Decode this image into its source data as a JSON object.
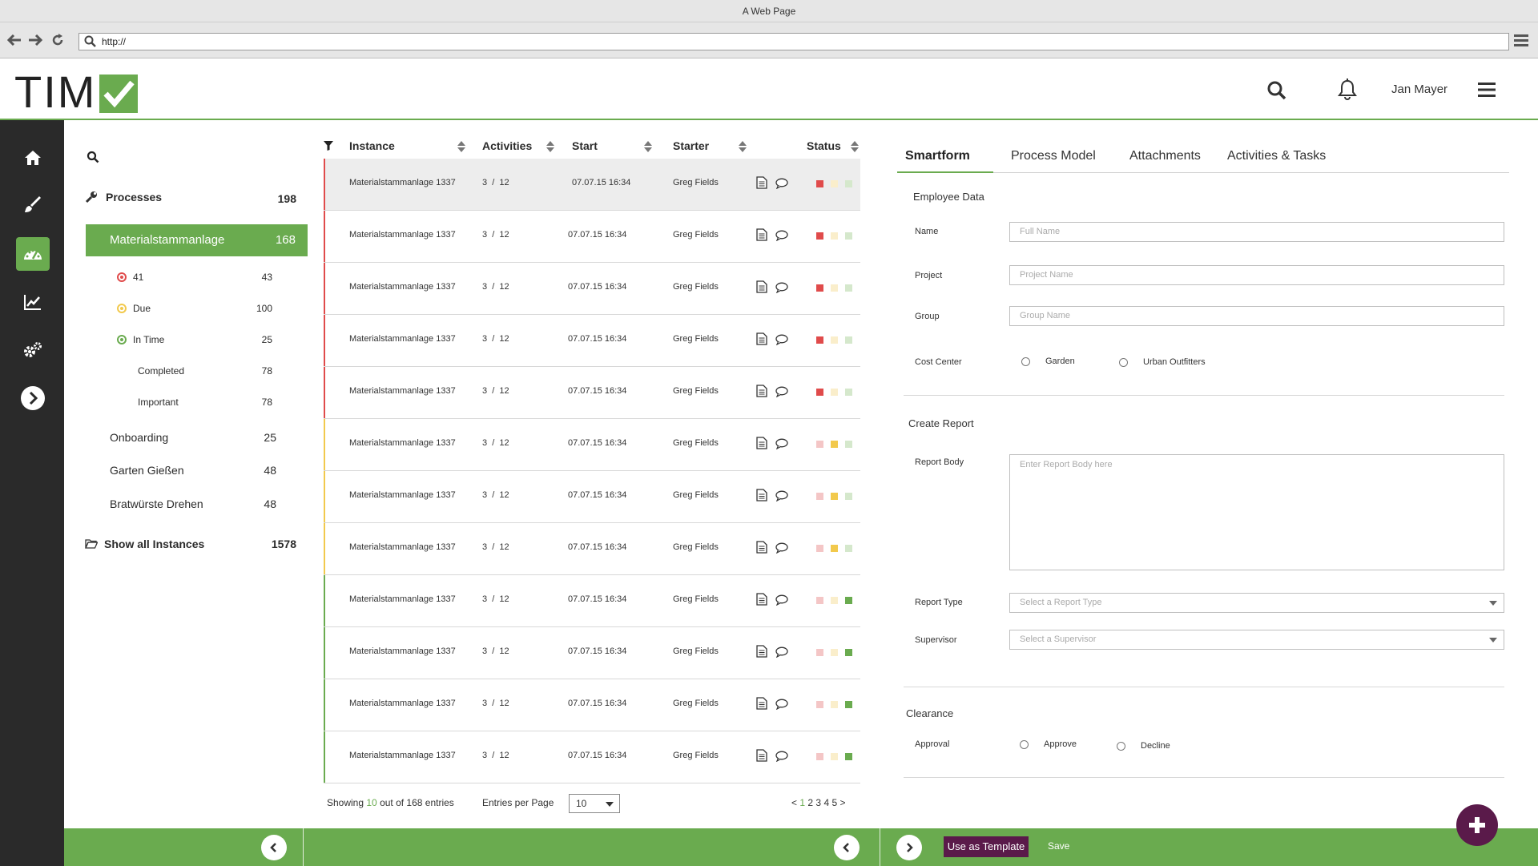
{
  "browser": {
    "title": "A Web Page",
    "url": "http://"
  },
  "header": {
    "logo_text": "TIM",
    "user_name": "Jan Mayer"
  },
  "processes": {
    "header_label": "Processes",
    "header_count": "198",
    "active": {
      "label": "Materialstammanlage",
      "count": "168"
    },
    "substatus": [
      {
        "label": "41",
        "count": "43",
        "color": "#e04b4b"
      },
      {
        "label": "Due",
        "count": "100",
        "color": "#f2c94c"
      },
      {
        "label": "In Time",
        "count": "25",
        "color": "#6aab4f"
      }
    ],
    "sublist": [
      {
        "label": "Completed",
        "count": "78"
      },
      {
        "label": "Important",
        "count": "78"
      }
    ],
    "others": [
      {
        "label": "Onboarding",
        "count": "25"
      },
      {
        "label": "Garten Gießen",
        "count": "48"
      },
      {
        "label": "Bratwürste Drehen",
        "count": "48"
      }
    ],
    "show_all": {
      "label": "Show all Instances",
      "count": "1578"
    }
  },
  "table": {
    "columns": [
      "Instance",
      "Activities",
      "Start",
      "Starter",
      "Status"
    ],
    "rows": [
      {
        "instance": "Materialstammanlage 1337",
        "activities": "3  /  12",
        "start": "07.07.15 16:34",
        "starter": "Greg Fields",
        "status": "red"
      },
      {
        "instance": "Materialstammanlage 1337",
        "activities": "3  /  12",
        "start": "07.07.15 16:34",
        "starter": "Greg Fields",
        "status": "red"
      },
      {
        "instance": "Materialstammanlage 1337",
        "activities": "3  /  12",
        "start": "07.07.15 16:34",
        "starter": "Greg Fields",
        "status": "red"
      },
      {
        "instance": "Materialstammanlage 1337",
        "activities": "3  /  12",
        "start": "07.07.15 16:34",
        "starter": "Greg Fields",
        "status": "red"
      },
      {
        "instance": "Materialstammanlage 1337",
        "activities": "3  /  12",
        "start": "07.07.15 16:34",
        "starter": "Greg Fields",
        "status": "red"
      },
      {
        "instance": "Materialstammanlage 1337",
        "activities": "3  /  12",
        "start": "07.07.15 16:34",
        "starter": "Greg Fields",
        "status": "yellow"
      },
      {
        "instance": "Materialstammanlage 1337",
        "activities": "3  /  12",
        "start": "07.07.15 16:34",
        "starter": "Greg Fields",
        "status": "yellow"
      },
      {
        "instance": "Materialstammanlage 1337",
        "activities": "3  /  12",
        "start": "07.07.15 16:34",
        "starter": "Greg Fields",
        "status": "yellow"
      },
      {
        "instance": "Materialstammanlage 1337",
        "activities": "3  /  12",
        "start": "07.07.15 16:34",
        "starter": "Greg Fields",
        "status": "green"
      },
      {
        "instance": "Materialstammanlage 1337",
        "activities": "3  /  12",
        "start": "07.07.15 16:34",
        "starter": "Greg Fields",
        "status": "green"
      },
      {
        "instance": "Materialstammanlage 1337",
        "activities": "3  /  12",
        "start": "07.07.15 16:34",
        "starter": "Greg Fields",
        "status": "green"
      },
      {
        "instance": "Materialstammanlage 1337",
        "activities": "3  /  12",
        "start": "07.07.15 16:34",
        "starter": "Greg Fields",
        "status": "green"
      }
    ],
    "footer": {
      "showing_prefix": "Showing",
      "showing_count": "10",
      "showing_suffix": "out of 168 entries",
      "entries_label": "Entries per Page",
      "entries_value": "10",
      "pages": [
        "1",
        "2",
        "3",
        "4",
        "5"
      ],
      "prev": "<",
      "next": ">"
    }
  },
  "colors": {
    "accent": "#6aab4f",
    "brand_purple": "#5a1a4a",
    "red": "#e04b4b",
    "red_light": "#f4c6c6",
    "yellow": "#f2c94c",
    "yellow_light": "#faeecb",
    "green": "#6aab4f",
    "green_light": "#d5e8cc"
  },
  "form": {
    "tabs": [
      "Smartform",
      "Process Model",
      "Attachments",
      "Activities & Tasks"
    ],
    "employee": {
      "title": "Employee Data",
      "name_label": "Name",
      "name_placeholder": "Full Name",
      "project_label": "Project",
      "project_placeholder": "Project Name",
      "group_label": "Group",
      "group_placeholder": "Group Name",
      "cost_center_label": "Cost Center",
      "cost_options": [
        "Garden",
        "Urban Outfitters"
      ]
    },
    "report": {
      "title": "Create Report",
      "body_label": "Report Body",
      "body_placeholder": "Enter Report Body here",
      "type_label": "Report Type",
      "type_placeholder": "Select a Report Type",
      "supervisor_label": "Supervisor",
      "supervisor_placeholder": "Select a Supervisor"
    },
    "clearance": {
      "title": "Clearance",
      "approval_label": "Approval",
      "options": [
        "Approve",
        "Decline"
      ]
    }
  },
  "bottom": {
    "template_label": "Use as Template",
    "save_label": "Save"
  }
}
